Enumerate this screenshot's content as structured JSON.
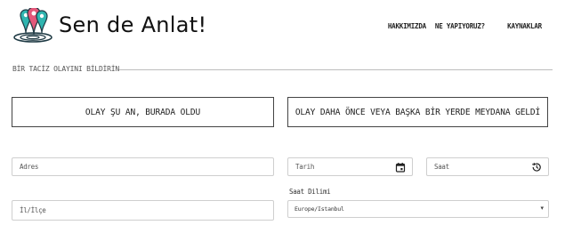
{
  "header": {
    "brand": "Sen de Anlat!",
    "nav": [
      {
        "label": "HAKKIMIZDA"
      },
      {
        "label": "NE YAPIYORUZ?"
      },
      {
        "label": "KAYNAKLAR"
      }
    ]
  },
  "form": {
    "section_title": "BİR TACİZ OLAYINI BİLDİRİN",
    "button_now": "OLAY ŞU AN, BURADA OLDU",
    "button_before": "OLAY DAHA ÖNCE VEYA BAŞKA BİR YERDE MEYDANA GELDİ",
    "adres_placeholder": "Adres",
    "tarih_placeholder": "Tarih",
    "saat_placeholder": "Saat",
    "ililce_placeholder": "İl/İlçe",
    "timezone_label": "Saat Dilimi",
    "timezone_value": "Europe/Istanbul"
  },
  "icons": {
    "logo": "map-pins-logo",
    "calendar": "calendar-icon",
    "clock": "clock-history-icon",
    "dropdown": "chevron-down-icon"
  },
  "colors": {
    "pin_pink": "#e4577a",
    "pin_teal": "#2fb5b0",
    "pin_dark": "#1f3a44",
    "border": "#cfcfcf",
    "button_border": "#444444"
  }
}
